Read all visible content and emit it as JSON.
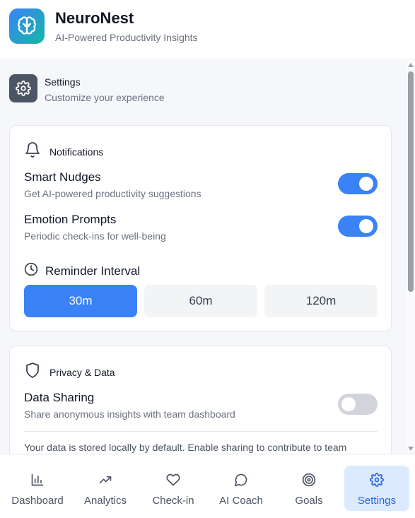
{
  "app": {
    "title": "NeuroNest",
    "subtitle": "AI-Powered Productivity Insights",
    "logo_icon": "brain-icon"
  },
  "section": {
    "title": "Settings",
    "subtitle": "Customize your experience",
    "icon": "gear-icon"
  },
  "notifications": {
    "title": "Notifications",
    "icon": "bell-icon",
    "smart_nudges": {
      "title": "Smart Nudges",
      "description": "Get AI-powered productivity suggestions",
      "enabled": true
    },
    "emotion_prompts": {
      "title": "Emotion Prompts",
      "description": "Periodic check-ins for well-being",
      "enabled": true
    },
    "reminder": {
      "title": "Reminder Interval",
      "icon": "clock-icon",
      "options": [
        "30m",
        "60m",
        "120m"
      ],
      "selected": "30m"
    }
  },
  "privacy": {
    "title": "Privacy & Data",
    "icon": "shield-icon",
    "data_sharing": {
      "title": "Data Sharing",
      "description": "Share anonymous insights with team dashboard",
      "enabled": false
    },
    "note": "Your data is stored locally by default. Enable sharing to contribute to team"
  },
  "nav": {
    "items": [
      {
        "label": "Dashboard",
        "icon": "bar-chart-icon"
      },
      {
        "label": "Analytics",
        "icon": "trending-up-icon"
      },
      {
        "label": "Check-in",
        "icon": "heart-icon"
      },
      {
        "label": "AI Coach",
        "icon": "chat-bubble-icon"
      },
      {
        "label": "Goals",
        "icon": "target-icon"
      },
      {
        "label": "Settings",
        "icon": "gear-icon"
      }
    ],
    "active": "Settings"
  },
  "colors": {
    "accent": "#3b82f6",
    "logo_gradient_start": "#3b82f6",
    "logo_gradient_end": "#14b8a6",
    "toggle_off": "#d1d5db",
    "nav_active_bg": "#dbeafe"
  }
}
